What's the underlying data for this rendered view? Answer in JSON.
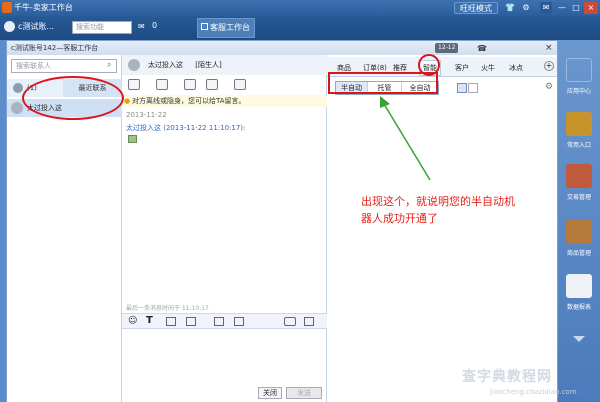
{
  "titlebar": {
    "title": "千牛-卖家工作台",
    "mode_label": "旺旺模式",
    "minimize": "—",
    "maximize": "□",
    "close": "×"
  },
  "toolbar": {
    "account": "c测试账...",
    "search_placeholder": "搜索功能",
    "message_count": "0",
    "workbench_label": "客服工作台"
  },
  "window": {
    "title": "c测试账号142—客服工作台",
    "badge": "12-12",
    "close": "×"
  },
  "left": {
    "search_placeholder": "搜索联系人",
    "tab_recent": "(1)",
    "tab_contacts": "最近联系",
    "contact_name": "太过投入这"
  },
  "chat": {
    "contact_name": "太过投入这",
    "contact_status": "[陌生人]",
    "notice": "对方离线或隐身，您可以给TA留言。",
    "date": "2013-11-22",
    "sender_line": "太过投入这 (2013-11-22 11:10:17):",
    "last_message": "最后一条消息时间于 11:10:17",
    "close_button": "关闭",
    "send_button": "发送"
  },
  "right_panel": {
    "tabs": [
      "商品",
      "订单(8)",
      "推荐",
      "智能",
      "客户",
      "火牛",
      "冰点"
    ],
    "modes": [
      "半自动",
      "托管",
      "全自动"
    ],
    "annotation": "出现这个，就说明您的半自动机器人成功开通了"
  },
  "sidebar": {
    "items": [
      "应用中心",
      "常用入口",
      "交易管理",
      "商品管理",
      "数据报表"
    ]
  },
  "watermark": {
    "text": "查字典教程网",
    "sub": "jiaocheng.chazidian.com"
  }
}
